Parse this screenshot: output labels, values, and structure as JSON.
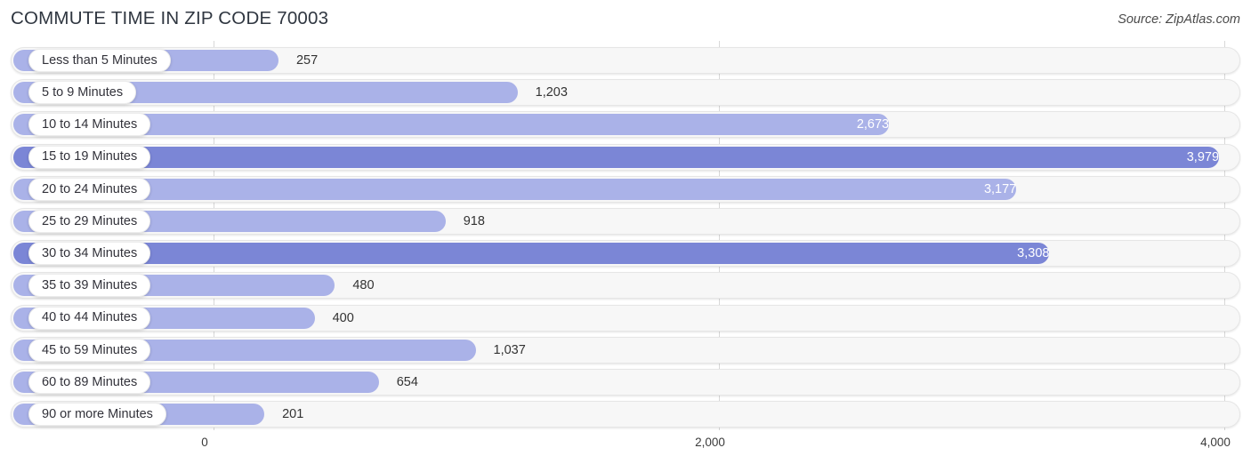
{
  "header": {
    "title": "COMMUTE TIME IN ZIP CODE 70003",
    "source": "Source: ZipAtlas.com"
  },
  "colors": {
    "bar_light": "#aab2e8",
    "bar_dark": "#7b86d6",
    "track": "#f7f7f7",
    "gridline": "#d8d8d8",
    "title_text": "#2f3640"
  },
  "axis": {
    "ticks": [
      "0",
      "2,000",
      "4,000"
    ],
    "tick_values": [
      0,
      2000,
      4000
    ],
    "min": 0,
    "max": 4000
  },
  "chart_data": {
    "type": "bar",
    "orientation": "horizontal",
    "title": "COMMUTE TIME IN ZIP CODE 70003",
    "subtitle": "Source: ZipAtlas.com",
    "xlabel": "",
    "ylabel": "",
    "xlim": [
      0,
      4000
    ],
    "grid": true,
    "legend": "none",
    "categories": [
      "Less than 5 Minutes",
      "5 to 9 Minutes",
      "10 to 14 Minutes",
      "15 to 19 Minutes",
      "20 to 24 Minutes",
      "25 to 29 Minutes",
      "30 to 34 Minutes",
      "35 to 39 Minutes",
      "40 to 44 Minutes",
      "45 to 59 Minutes",
      "60 to 89 Minutes",
      "90 or more Minutes"
    ],
    "values": [
      257,
      1203,
      2673,
      3979,
      3177,
      918,
      3308,
      480,
      400,
      1037,
      654,
      201
    ],
    "value_labels": [
      "257",
      "1,203",
      "2,673",
      "3,979",
      "3,177",
      "918",
      "3,308",
      "480",
      "400",
      "1,037",
      "654",
      "201"
    ]
  },
  "rows": [
    {
      "label": "Less than 5 Minutes",
      "value": 257,
      "value_label": "257",
      "shade": "light",
      "label_inside": false
    },
    {
      "label": "5 to 9 Minutes",
      "value": 1203,
      "value_label": "1,203",
      "shade": "light",
      "label_inside": false
    },
    {
      "label": "10 to 14 Minutes",
      "value": 2673,
      "value_label": "2,673",
      "shade": "light",
      "label_inside": true
    },
    {
      "label": "15 to 19 Minutes",
      "value": 3979,
      "value_label": "3,979",
      "shade": "dark",
      "label_inside": true
    },
    {
      "label": "20 to 24 Minutes",
      "value": 3177,
      "value_label": "3,177",
      "shade": "light",
      "label_inside": true
    },
    {
      "label": "25 to 29 Minutes",
      "value": 918,
      "value_label": "918",
      "shade": "light",
      "label_inside": false
    },
    {
      "label": "30 to 34 Minutes",
      "value": 3308,
      "value_label": "3,308",
      "shade": "dark",
      "label_inside": true
    },
    {
      "label": "35 to 39 Minutes",
      "value": 480,
      "value_label": "480",
      "shade": "light",
      "label_inside": false
    },
    {
      "label": "40 to 44 Minutes",
      "value": 400,
      "value_label": "400",
      "shade": "light",
      "label_inside": false
    },
    {
      "label": "45 to 59 Minutes",
      "value": 1037,
      "value_label": "1,037",
      "shade": "light",
      "label_inside": false
    },
    {
      "label": "60 to 89 Minutes",
      "value": 654,
      "value_label": "654",
      "shade": "light",
      "label_inside": false
    },
    {
      "label": "90 or more Minutes",
      "value": 201,
      "value_label": "201",
      "shade": "light",
      "label_inside": false
    }
  ]
}
